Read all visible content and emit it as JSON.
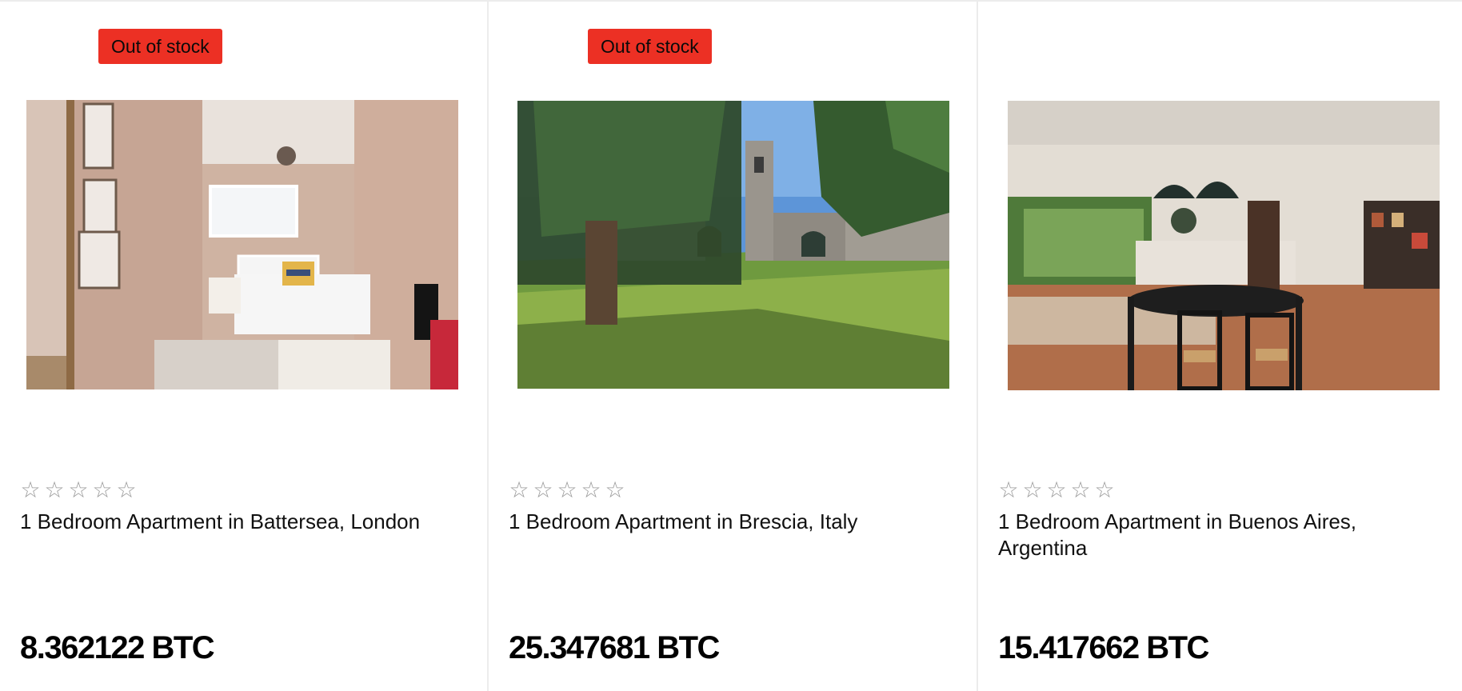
{
  "products": [
    {
      "badge": "Out of stock",
      "image_icon": "bedroom-photo",
      "rating_stars": [
        "☆",
        "☆",
        "☆",
        "☆",
        "☆"
      ],
      "title": "1 Bedroom Apartment in Battersea, London",
      "price": "8.362122 BTC"
    },
    {
      "badge": "Out of stock",
      "image_icon": "stone-villa-photo",
      "rating_stars": [
        "☆",
        "☆",
        "☆",
        "☆",
        "☆"
      ],
      "title": "1 Bedroom Apartment in Brescia, Italy",
      "price": "25.347681 BTC"
    },
    {
      "image_icon": "dining-room-photo",
      "rating_stars": [
        "☆",
        "☆",
        "☆",
        "☆",
        "☆"
      ],
      "title": "1 Bedroom Apartment in Buenos Aires, Argentina",
      "price": "15.417662 BTC"
    }
  ],
  "colors": {
    "badge_background": "#ec3024",
    "star_outline": "#9a9a9a",
    "divider": "#ececec"
  }
}
